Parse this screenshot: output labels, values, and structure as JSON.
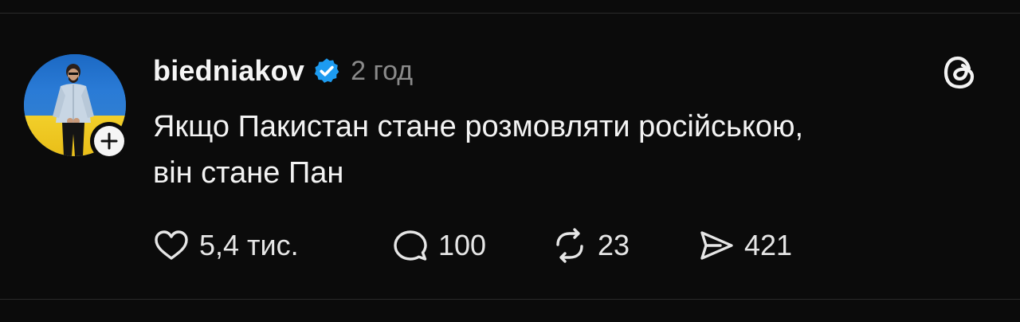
{
  "post": {
    "username": "biedniakov",
    "time": "2 год",
    "text_lines": [
      "Якщо Пакистан стане розмовляти російською,",
      "він стане Пан"
    ],
    "avatar": {
      "description_icon": "avatar",
      "follow_icon": "plus-icon"
    },
    "verified_icon": "verified-badge-icon",
    "brand_icon": "threads-logo-icon"
  },
  "actions": {
    "like": {
      "icon": "heart-icon",
      "count": "5,4 тис."
    },
    "reply": {
      "icon": "comment-icon",
      "count": "100"
    },
    "repost": {
      "icon": "repost-icon",
      "count": "23"
    },
    "share": {
      "icon": "send-icon",
      "count": "421"
    }
  },
  "colors": {
    "background": "#0b0b0b",
    "text": "#f3f3f3",
    "muted": "#8a8a8a",
    "verified": "#1d9bf0"
  }
}
